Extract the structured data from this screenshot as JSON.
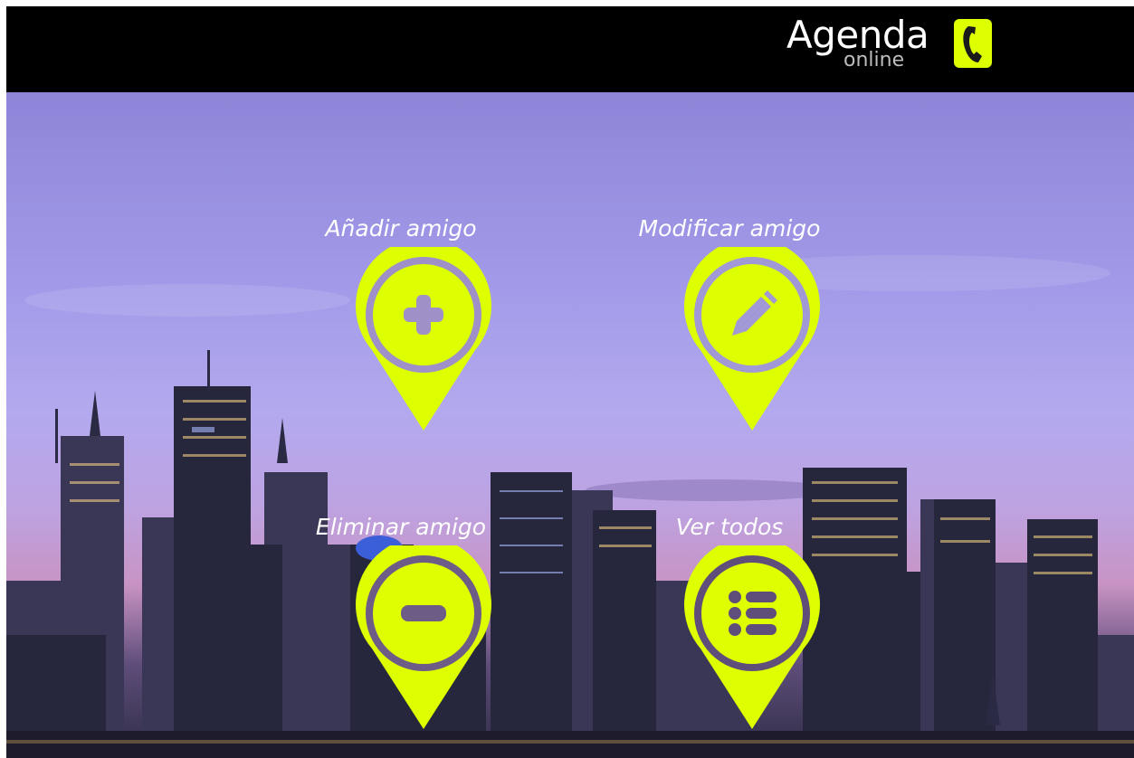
{
  "header": {
    "logo_title": "Agenda",
    "logo_subtitle": "online",
    "logo_icon": "phone-icon"
  },
  "menu": {
    "add": {
      "label": "Añadir amigo",
      "icon": "plus-icon"
    },
    "edit": {
      "label": "Modificar amigo",
      "icon": "pencil-icon"
    },
    "delete": {
      "label": "Eliminar amigo",
      "icon": "minus-icon"
    },
    "list": {
      "label": "Ver todos",
      "icon": "list-icon"
    }
  },
  "colors": {
    "accent": "#ddff00",
    "header_bg": "#000000",
    "label_text": "#ffffff"
  }
}
